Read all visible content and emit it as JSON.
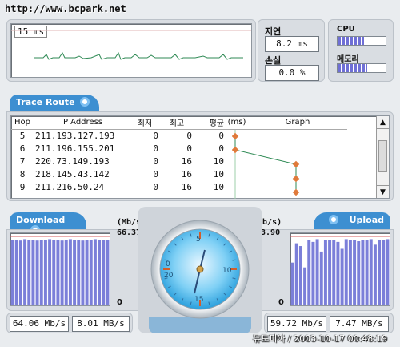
{
  "watermark_top": "http://www.bcpark.net",
  "ping": {
    "value": "15 ms"
  },
  "latency": {
    "label": "지연",
    "value": "8.2 ms"
  },
  "loss": {
    "label": "손실",
    "value": "0.0 %"
  },
  "cpu": {
    "label": "CPU",
    "fill": 0.55
  },
  "memory": {
    "label": "메모리",
    "fill": 0.62
  },
  "trace": {
    "tab_label": "Trace Route",
    "headers": [
      "Hop",
      "IP Address",
      "최저",
      "최고",
      "평균",
      "(ms)",
      "Graph"
    ],
    "rows": [
      {
        "hop": "5",
        "ip": "211.193.127.193",
        "min": "0",
        "max": "0",
        "avg": "0"
      },
      {
        "hop": "6",
        "ip": "211.196.155.201",
        "min": "0",
        "max": "0",
        "avg": "0"
      },
      {
        "hop": "7",
        "ip": "220.73.149.193",
        "min": "0",
        "max": "16",
        "avg": "10"
      },
      {
        "hop": "8",
        "ip": "218.145.43.142",
        "min": "0",
        "max": "16",
        "avg": "10"
      },
      {
        "hop": "9",
        "ip": "211.216.50.24",
        "min": "0",
        "max": "16",
        "avg": "10"
      }
    ]
  },
  "download": {
    "tab_label": "Download",
    "unit": "(Mb/s)",
    "max_label": "66.37",
    "zero_label": "0",
    "current": "64.06 Mb/s",
    "average": "8.01 MB/s",
    "bars": [
      0.95,
      0.95,
      0.94,
      0.96,
      0.95,
      0.95,
      0.94,
      0.95,
      0.95,
      0.96,
      0.95,
      0.95,
      0.94,
      0.95,
      0.96,
      0.95,
      0.95,
      0.94,
      0.95,
      0.95,
      0.96,
      0.95,
      0.95,
      0.95
    ]
  },
  "upload": {
    "tab_label": "Upload",
    "unit": "(Mb/s)",
    "max_label": "63.90",
    "zero_label": "0",
    "current": "59.72 Mb/s",
    "average": "7.47 MB/s",
    "bars": [
      0.62,
      0.9,
      0.86,
      0.55,
      0.95,
      0.92,
      0.96,
      0.78,
      0.95,
      0.95,
      0.95,
      0.92,
      0.82,
      0.96,
      0.95,
      0.95,
      0.93,
      0.95,
      0.95,
      0.96,
      0.88,
      0.95,
      0.95,
      0.96
    ]
  },
  "gauge": {
    "ticks": [
      "5",
      "10",
      "15",
      "20",
      "0"
    ]
  },
  "footer": "뮤토피아 / 2003-10-17 00:48:19"
}
